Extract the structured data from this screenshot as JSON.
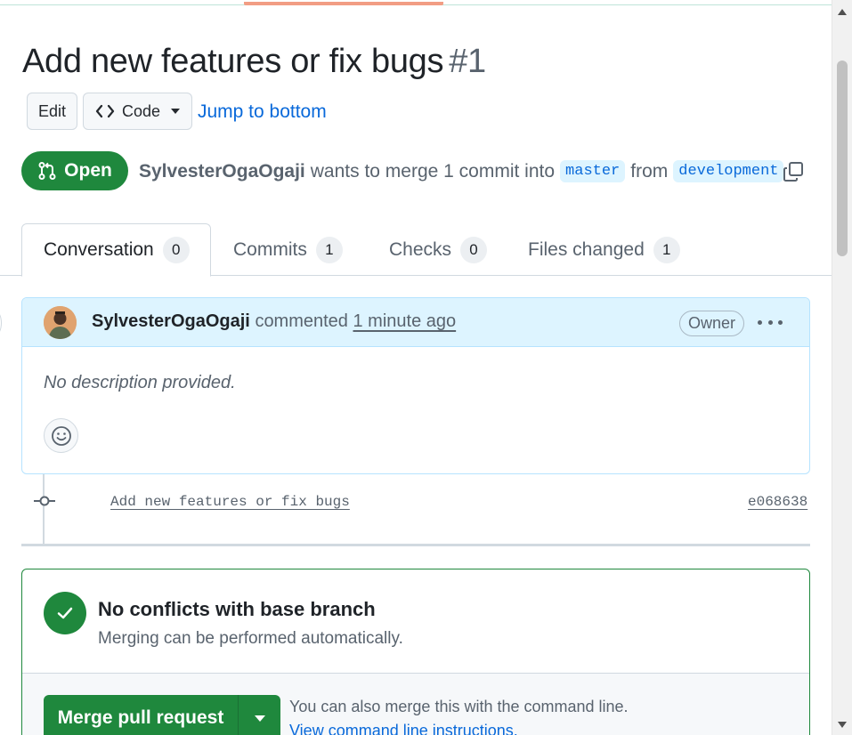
{
  "pr": {
    "title": "Add new features or fix bugs",
    "number": "#1",
    "state": "Open",
    "author": "SylvesterOgaOgaji",
    "merge_text": "wants to merge 1 commit into",
    "base_branch": "master",
    "from_text": "from",
    "head_branch": "development"
  },
  "header_actions": {
    "edit_label": "Edit",
    "code_label": "Code",
    "jump_label": "Jump to bottom"
  },
  "tabs": [
    {
      "label": "Conversation",
      "count": "0"
    },
    {
      "label": "Commits",
      "count": "1"
    },
    {
      "label": "Checks",
      "count": "0"
    },
    {
      "label": "Files changed",
      "count": "1"
    }
  ],
  "comment": {
    "author": "SylvesterOgaOgaji",
    "action": "commented",
    "time": "1 minute ago",
    "role_badge": "Owner",
    "body": "No description provided."
  },
  "commit": {
    "message": "Add new features or fix bugs",
    "sha": "e068638"
  },
  "merge": {
    "heading": "No conflicts with base branch",
    "subtext": "Merging can be performed automatically.",
    "button_label": "Merge pull request",
    "cli_text": "You can also merge this with the command line.",
    "cli_link": "View command line instructions."
  },
  "colors": {
    "success": "#1f883d",
    "link": "#0969da",
    "branch_bg": "#ddf4ff",
    "header_bg": "#ddf4ff"
  },
  "icons": [
    "git-pull-request-icon",
    "code-icon",
    "copy-icon",
    "kebab-horizontal-icon",
    "smiley-icon",
    "git-commit-icon",
    "check-icon",
    "triangle-down-icon"
  ]
}
